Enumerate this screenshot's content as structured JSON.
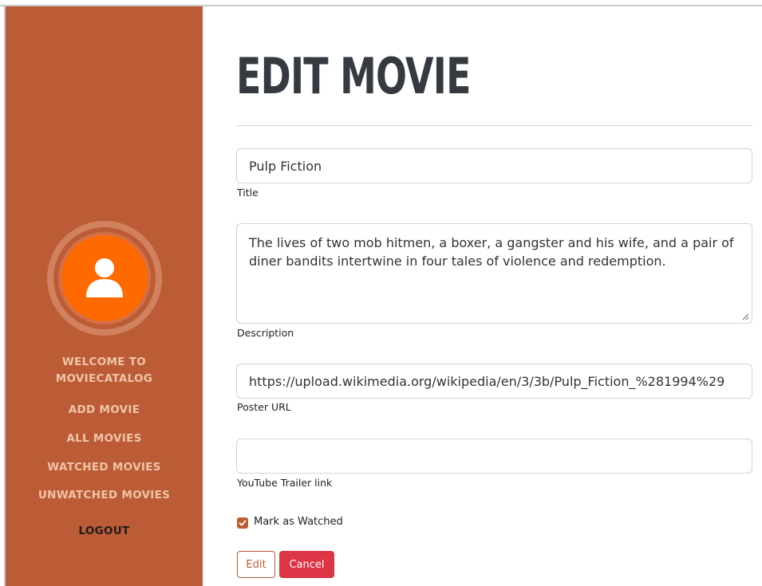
{
  "sidebar": {
    "nav": {
      "welcome_line1": "WELCOME TO",
      "welcome_line2": "MOVIECATALOG",
      "add_movie": "ADD MOVIE",
      "all_movies": "ALL MOVIES",
      "watched_movies": "WATCHED MOVIES",
      "unwatched_movies": "UNWATCHED MOVIES",
      "logout": "LOGOUT"
    },
    "avatar_icon": "user-icon"
  },
  "main": {
    "page_title": "EDIT MOVIE",
    "form": {
      "title_value": "Pulp Fiction",
      "title_label": "Title",
      "description_value": "The lives of two mob hitmen, a boxer, a gangster and his wife, and a pair of diner bandits intertwine in four tales of violence and redemption.",
      "description_label": "Description",
      "poster_value": "https://upload.wikimedia.org/wikipedia/en/3/3b/Pulp_Fiction_%281994%29",
      "poster_label": "Poster URL",
      "trailer_value": "",
      "trailer_label": "YouTube Trailer link",
      "watched_label": "Mark as Watched",
      "watched_checked": true
    },
    "buttons": {
      "edit": "Edit",
      "cancel": "Cancel"
    }
  },
  "colors": {
    "sidebar_bg": "#bc5c36",
    "avatar_orange": "#ff6a00",
    "nav_text": "#f0c4a8",
    "cancel_red": "#dc3545",
    "title_dark": "#343a40"
  }
}
